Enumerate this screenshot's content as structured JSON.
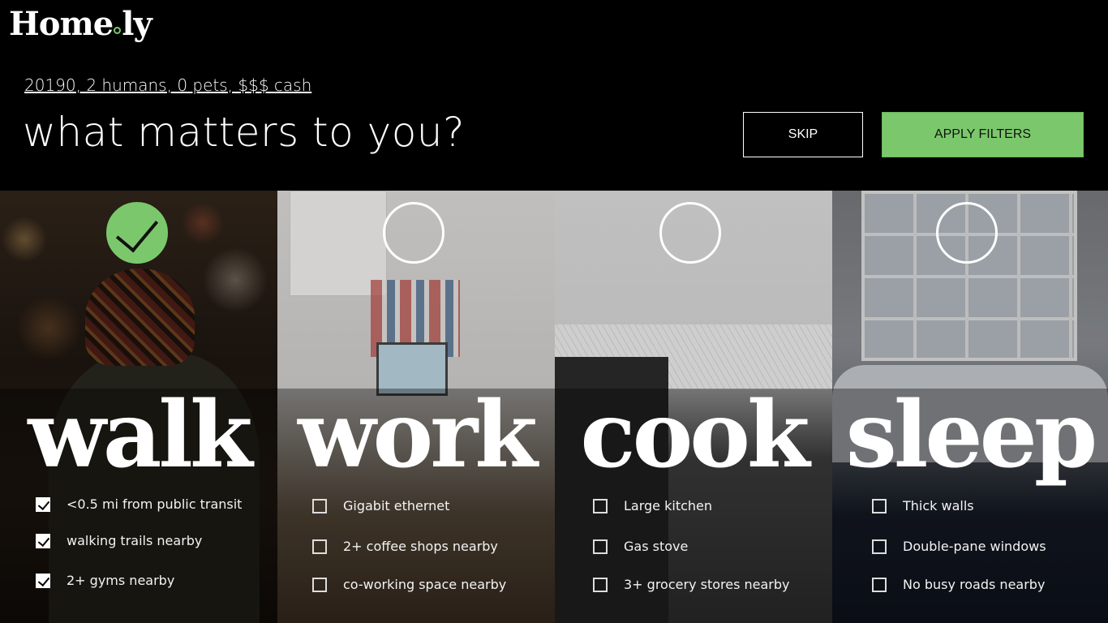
{
  "brand": {
    "logo_prefix": "Home",
    "logo_suffix": "ly",
    "accent_color": "#7bc86c"
  },
  "header": {
    "summary_link": "20190, 2 humans, 0 pets, $$$ cash",
    "title": "what matters to you?",
    "skip_label": "SKIP",
    "apply_label": "APPLY FILTERS"
  },
  "categories": [
    {
      "word": "walk",
      "selected": true,
      "options": [
        {
          "label": "<0.5 mi from public transit",
          "checked": true
        },
        {
          "label": "walking trails nearby",
          "checked": true
        },
        {
          "label": "2+ gyms nearby",
          "checked": true
        }
      ]
    },
    {
      "word": "work",
      "selected": false,
      "options": [
        {
          "label": "Gigabit ethernet",
          "checked": false
        },
        {
          "label": "2+ coffee shops nearby",
          "checked": false
        },
        {
          "label": "co-working space nearby",
          "checked": false
        }
      ]
    },
    {
      "word": "cook",
      "selected": false,
      "options": [
        {
          "label": "Large kitchen",
          "checked": false
        },
        {
          "label": "Gas stove",
          "checked": false
        },
        {
          "label": "3+ grocery stores nearby",
          "checked": false
        }
      ]
    },
    {
      "word": "sleep",
      "selected": false,
      "options": [
        {
          "label": "Thick walls",
          "checked": false
        },
        {
          "label": "Double-pane windows",
          "checked": false
        },
        {
          "label": "No busy roads nearby",
          "checked": false
        }
      ]
    }
  ]
}
